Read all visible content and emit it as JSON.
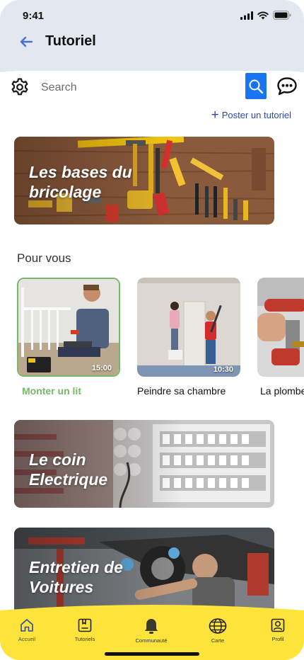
{
  "status_bar": {
    "time": "9:41"
  },
  "header": {
    "title": "Tutoriel"
  },
  "search": {
    "placeholder": "Search"
  },
  "post_tutorial_label": "Poster un tutoriel",
  "banners": [
    {
      "title": "Les bases du\nbricolage"
    },
    {
      "title": "Le coin\nElectrique"
    },
    {
      "title": "Entretien de\nVoitures"
    }
  ],
  "for_you": {
    "title": "Pour vous",
    "videos": [
      {
        "label": "Monter un lit",
        "duration": "15:00"
      },
      {
        "label": "Peindre sa chambre",
        "duration": "10:30"
      },
      {
        "label": "La plomberie",
        "duration": ""
      }
    ]
  },
  "bottom_nav": [
    {
      "label": "Accueil",
      "icon": "home-icon"
    },
    {
      "label": "Tutoriels",
      "icon": "tutorials-icon"
    },
    {
      "label": "Communauté",
      "icon": "bell-icon"
    },
    {
      "label": "Carte",
      "icon": "globe-icon"
    },
    {
      "label": "Profil",
      "icon": "profile-icon"
    }
  ],
  "colors": {
    "header_bg": "#e3e7f0",
    "accent_blue": "#1a73f0",
    "link_blue": "#3048a8",
    "active_green": "#79b86a",
    "nav_yellow": "#fde33a"
  }
}
